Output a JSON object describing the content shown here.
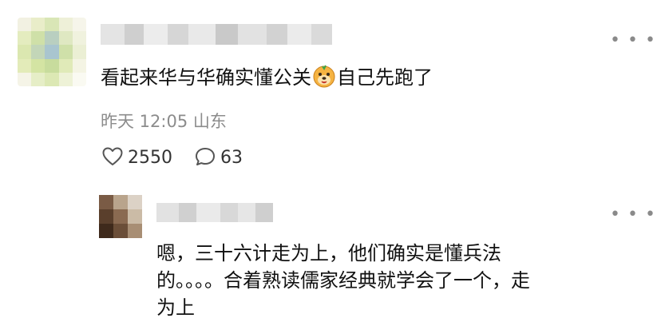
{
  "main_comment": {
    "avatar": "pixelated-avatar",
    "username": "",
    "text_before_emoji": "看起来华与华确实懂公关",
    "emoji": "dog-face-emoji",
    "text_after_emoji": "自己先跑了",
    "time": "昨天 12:05",
    "location": "山东",
    "likes": "2550",
    "replies": "63",
    "more_icon": "more-dots-icon"
  },
  "reply": {
    "avatar": "pixelated-avatar",
    "username": "",
    "text_lines": [
      "嗯，三十六计走为上，他们确实是懂兵法",
      "的。。。。合着熟读儒家经典就学会了一个，走",
      "为上"
    ],
    "more_icon": "more-dots-icon"
  },
  "colors": {
    "text": "#111111",
    "meta": "#8c8c8c",
    "icon": "#555555"
  }
}
